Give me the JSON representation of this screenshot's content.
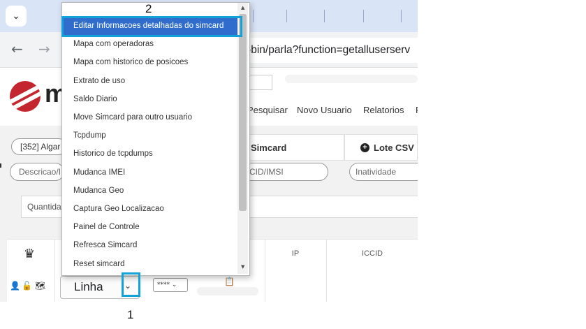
{
  "browser": {
    "url_fragment": "gi-bin/parla?function=getalluserserv"
  },
  "app": {
    "logo_letter": "m",
    "menu": [
      "Pesquisar",
      "Novo Usuario",
      "Relatorios",
      "F"
    ]
  },
  "panel": {
    "operator_select": "[352] Algar",
    "tabs": [
      "Simcard",
      "Lote CSV"
    ],
    "lote_icon": "plus-circle-icon",
    "fields": {
      "descricao": "Descricao/I",
      "iccid_imsi": "CID/IMSI",
      "inatividade": "Inatividade"
    },
    "quantidade_label": "Quantida"
  },
  "table": {
    "headers": [
      "IP",
      "ICCID"
    ],
    "crown_icon": "crown-icon",
    "row": {
      "line_select_value": "Linha",
      "small_select_value": "****"
    }
  },
  "dropdown": {
    "selected_index": 0,
    "options": [
      "Editar Informacoes detalhadas do simcard",
      "Mapa com operadoras",
      "Mapa com historico de posicoes",
      "Extrato de uso",
      "Saldo Diario",
      "Move Simcard para outro usuario",
      "Tcpdump",
      "Historico de tcpdumps",
      "Mudanca IMEI",
      "Mudanca Geo",
      "Captura Geo Localizacao",
      "Painel de Controle",
      "Refresca Simcard",
      "Reset simcard"
    ]
  },
  "annotations": {
    "label_1": "1",
    "label_2": "2",
    "highlight_color": "#12a2d8"
  },
  "colors": {
    "selected_option": "#2f6ccc",
    "logo_red": "#c3262f",
    "tab_strip": "#d9e4f7"
  }
}
